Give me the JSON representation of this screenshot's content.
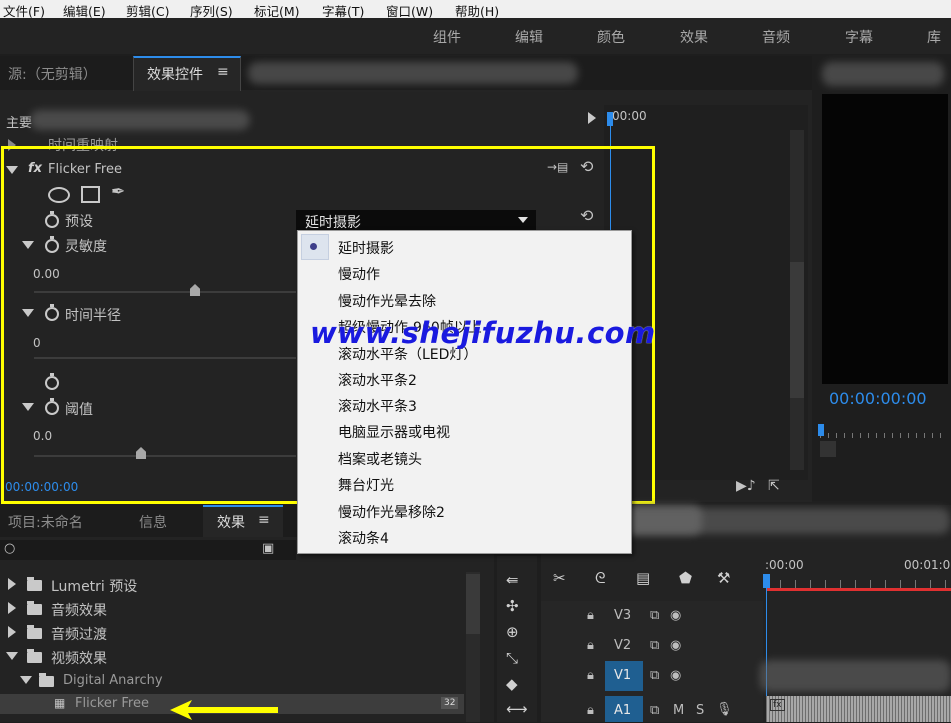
{
  "menu": [
    "文件(F)",
    "编辑(E)",
    "剪辑(C)",
    "序列(S)",
    "标记(M)",
    "字幕(T)",
    "窗口(W)",
    "帮助(H)"
  ],
  "workspaces": [
    "组件",
    "编辑",
    "颜色",
    "效果",
    "音频",
    "字幕",
    "库"
  ],
  "source_tab": "源:（无剪辑）",
  "effect_controls_tab": "效果控件",
  "tab_menu_glyph": "≡",
  "master_label": "主要",
  "time_remap": "时间重映射",
  "effect_name": "Flicker Free",
  "fx_label": "fx",
  "preset_label": "预设",
  "preset_value": "延时摄影",
  "sensitivity_label": "灵敏度",
  "sensitivity_value": "0.00",
  "time_radius_label": "时间半径",
  "time_radius_value": "0",
  "threshold_label": "阈值",
  "threshold_value": "0.0",
  "ec_timecode": "00:00:00:00",
  "ec_ruler_time": "00:00",
  "program_timecode": "00:00:00:00",
  "dropdown_items": [
    "延时摄影",
    "慢动作",
    "慢动作光晕去除",
    "超级慢动作-960帧以上",
    "滚动水平条（LED灯）",
    "滚动水平条2",
    "滚动水平条3",
    "电脑显示器或电视",
    "档案或老镜头",
    "舞台灯光",
    "慢动作光晕移除2",
    "滚动条4"
  ],
  "watermark": "www.shejifuzhu.com",
  "bottom_tabs": [
    "项目:未命名",
    "信息",
    "效果"
  ],
  "effects_list": [
    {
      "label": "Lumetri 预设"
    },
    {
      "label": "音频效果"
    },
    {
      "label": "音频过渡"
    },
    {
      "label": "视频效果"
    },
    {
      "label": "Digital Anarchy"
    },
    {
      "label": "Flicker Free"
    }
  ],
  "badge_32": "32",
  "tracks": [
    "V3",
    "V2",
    "V1",
    "A1"
  ],
  "track_ms": [
    "M",
    "S"
  ],
  "fx_badge": "fx",
  "timeline_ruler": [
    ":00:00",
    "00:01:0"
  ],
  "colors": {
    "accent": "#2d8ceb",
    "highlight": "#ffff00",
    "arrow": "#ffff00",
    "playhead": "#e03030"
  }
}
